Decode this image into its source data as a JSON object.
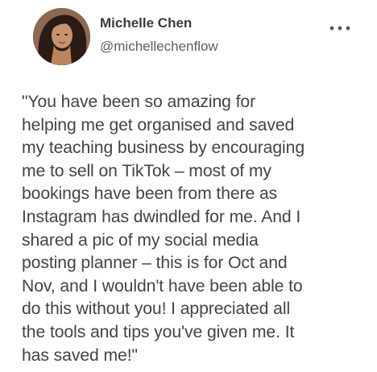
{
  "author": {
    "name": "Michelle Chen",
    "handle": "@michellechenflow",
    "avatar_icon": "profile-photo"
  },
  "menu": {
    "icon": "more-horizontal-icon"
  },
  "post": {
    "lines": [
      "\"You have been so amazing for",
      "helping me get organised and saved",
      "my teaching business by encouraging",
      "me to sell on TikTok – most of my",
      "bookings have been from there as",
      "Instagram has dwindled for me. And I",
      "shared a pic of my social media",
      "posting planner – this is for Oct and",
      "Nov, and I wouldn't have been able to",
      "do this without you! I appreciated all",
      "the tools and tips you've given me. It",
      "has saved me!\""
    ]
  },
  "colors": {
    "name_text": "#3b3b3b",
    "handle_text": "#5f5f5f",
    "body_text": "#444444",
    "background": "#ffffff"
  }
}
